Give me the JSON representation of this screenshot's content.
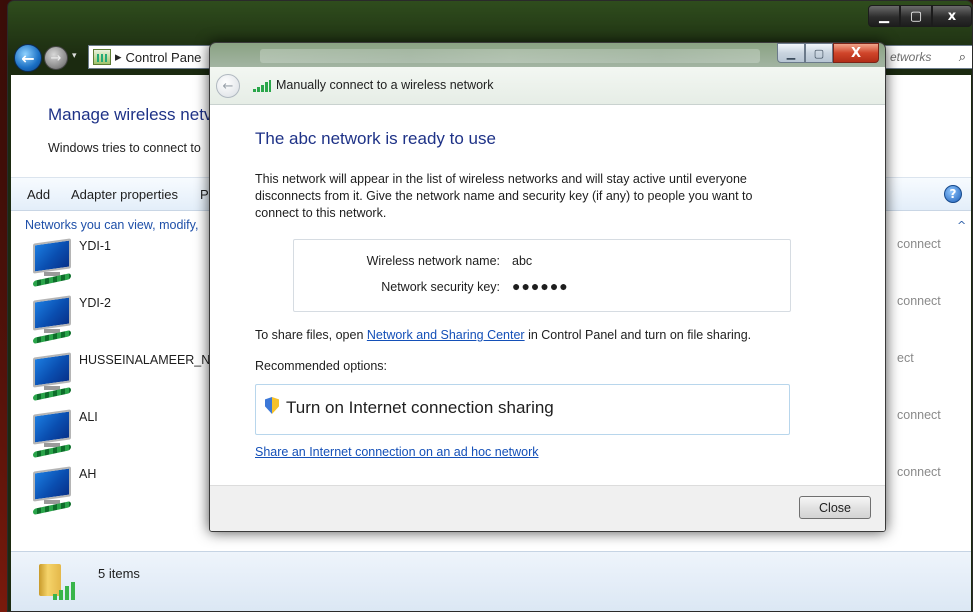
{
  "background_window": {
    "frame_controls": {
      "minimize": "▁",
      "maximize": "▢",
      "close": "x"
    },
    "nav": {
      "back_icon": "back-arrow-icon",
      "forward_icon": "forward-arrow-icon",
      "dropdown": "▾",
      "address_separator": "▸",
      "address_text": "Control Pane",
      "search_text": "etworks",
      "search_icon": "⌕"
    },
    "page_title": "Manage wireless netv",
    "page_description": "Windows tries to connect to",
    "toolbar": {
      "add": "Add",
      "adapter_properties": "Adapter properties",
      "truncated": "P",
      "help": "?"
    },
    "networks_header": "Networks you can view, modify,",
    "collapse_icon": "^",
    "networks": [
      {
        "name": "YDI-1",
        "action": "connect"
      },
      {
        "name": "YDI-2",
        "action": "connect"
      },
      {
        "name": "HUSSEINALAMEER_Ne",
        "action": "ect"
      },
      {
        "name": "ALI",
        "action": "connect"
      },
      {
        "name": "AH",
        "action": "connect"
      }
    ],
    "status": {
      "item_count": "5 items"
    }
  },
  "dialog": {
    "title_controls": {
      "minimize": "▁",
      "maximize": "▢",
      "close": "X"
    },
    "back_icon": "←",
    "header_title": "Manually connect to a wireless network",
    "heading": "The abc network is ready to use",
    "paragraph": "This network will appear in the list of wireless networks and will stay active until everyone disconnects from it. Give the network name and security key (if any) to people you want to connect to this network.",
    "info": {
      "name_label": "Wireless network name:",
      "name_value": "abc",
      "key_label": "Network security key:",
      "key_value": "●●●●●●"
    },
    "share_prefix": "To share files, open ",
    "share_link": "Network and Sharing Center",
    "share_suffix": " in Control Panel and turn on file sharing.",
    "recommended_label": "Recommended options:",
    "ics_option": "Turn on Internet connection sharing",
    "adhoc_link": "Share an Internet connection on an ad hoc network",
    "close_button": "Close"
  }
}
